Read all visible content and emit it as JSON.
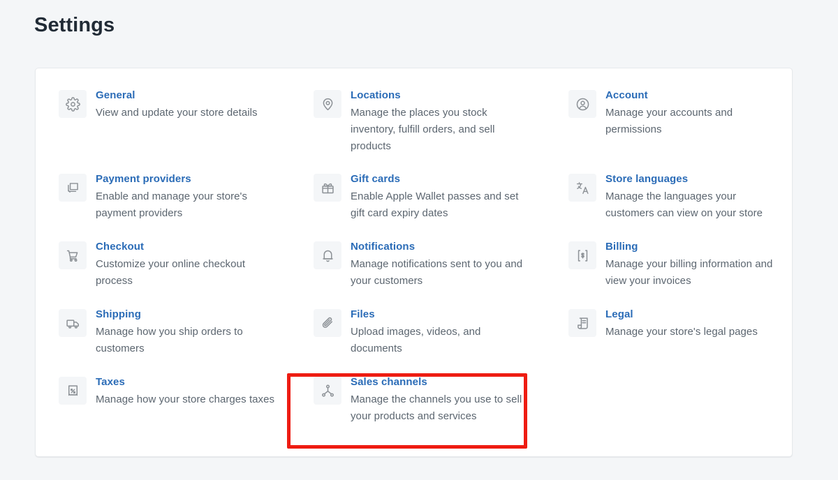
{
  "page": {
    "title": "Settings",
    "background_color": "#f4f6f8",
    "card_background": "#ffffff",
    "link_color": "#2b6cb7",
    "description_color": "#5c6670",
    "icon_tile_color": "#f4f6f8",
    "highlight_color": "#ee1c12"
  },
  "settings": {
    "columns": [
      {
        "items": [
          {
            "icon": "gear-icon",
            "title": "General",
            "description": "View and update your store details"
          },
          {
            "icon": "payment-card-icon",
            "title": "Payment providers",
            "description": "Enable and manage your store's payment providers"
          },
          {
            "icon": "shopping-cart-icon",
            "title": "Checkout",
            "description": "Customize your online checkout process"
          },
          {
            "icon": "delivery-truck-icon",
            "title": "Shipping",
            "description": "Manage how you ship orders to customers"
          },
          {
            "icon": "receipt-percent-icon",
            "title": "Taxes",
            "description": "Manage how your store charges taxes"
          }
        ]
      },
      {
        "items": [
          {
            "icon": "location-pin-icon",
            "title": "Locations",
            "description": "Manage the places you stock inventory, fulfill orders, and sell products"
          },
          {
            "icon": "gift-card-icon",
            "title": "Gift cards",
            "description": "Enable Apple Wallet passes and set gift card expiry dates"
          },
          {
            "icon": "bell-icon",
            "title": "Notifications",
            "description": "Manage notifications sent to you and your customers"
          },
          {
            "icon": "paperclip-icon",
            "title": "Files",
            "description": "Upload images, videos, and documents"
          },
          {
            "icon": "sales-channels-icon",
            "title": "Sales channels",
            "description": "Manage the channels you use to sell your products and services",
            "highlighted": true
          }
        ]
      },
      {
        "items": [
          {
            "icon": "account-person-icon",
            "title": "Account",
            "description": "Manage your accounts and permissions"
          },
          {
            "icon": "translate-icon",
            "title": "Store languages",
            "description": "Manage the languages your customers can view on your store"
          },
          {
            "icon": "receipt-dollar-icon",
            "title": "Billing",
            "description": "Manage your billing information and view your invoices"
          },
          {
            "icon": "legal-scroll-icon",
            "title": "Legal",
            "description": "Manage your store's legal pages"
          }
        ]
      }
    ]
  }
}
